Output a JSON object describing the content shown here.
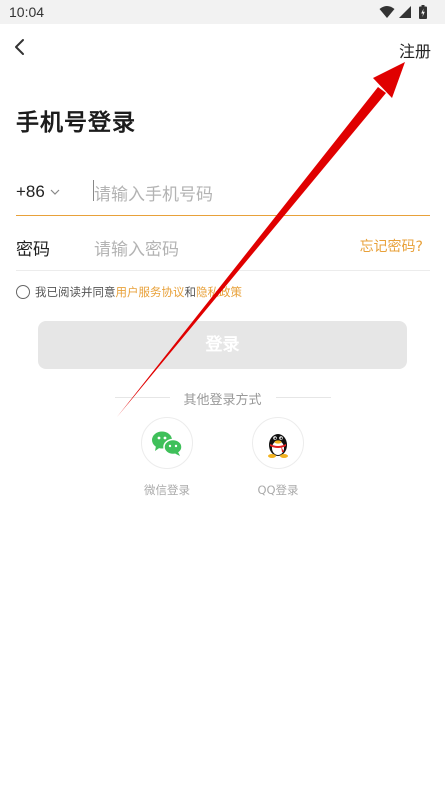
{
  "status_bar": {
    "time": "10:04",
    "icons": [
      "wifi-icon",
      "signal-icon",
      "battery-icon"
    ]
  },
  "header": {
    "back_icon": "back-arrow-icon",
    "register_label": "注册"
  },
  "title": "手机号登录",
  "phone": {
    "country_code": "+86",
    "placeholder": "请输入手机号码"
  },
  "password": {
    "label": "密码",
    "placeholder": "请输入密码",
    "forgot_label": "忘记密码?"
  },
  "agreement": {
    "prefix": "我已阅读并同意",
    "user_agreement": "用户服务协议",
    "joiner": "和",
    "privacy_policy": "隐私政策"
  },
  "login_button": "登录",
  "other_login": {
    "label": "其他登录方式",
    "methods": [
      {
        "label": "微信登录",
        "icon": "wechat-icon"
      },
      {
        "label": "QQ登录",
        "icon": "qq-icon"
      }
    ]
  },
  "colors": {
    "accent": "#e8a13a",
    "annotation_arrow": "#e00000",
    "wechat": "#3fc05a"
  }
}
